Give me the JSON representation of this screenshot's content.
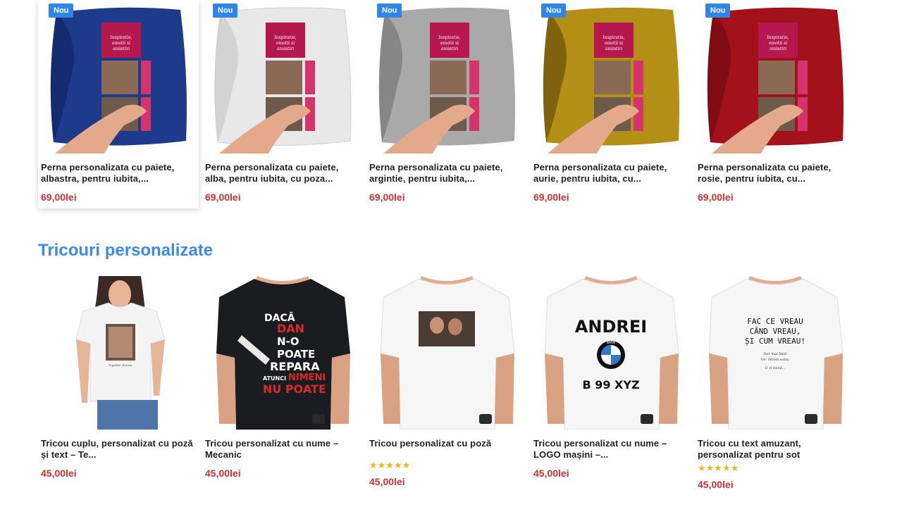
{
  "pillows": [
    {
      "badge": "Nou",
      "title": "Perna personalizata cu paiete, albastra, pentru iubita,...",
      "price": "69,00lei",
      "color": "#1e3a8a",
      "shade": "#0f2160"
    },
    {
      "badge": "Nou",
      "title": "Perna personalizata cu paiete, alba, pentru iubita, cu poza...",
      "price": "69,00lei",
      "color": "#e7e7e7",
      "shade": "#bdbdbd"
    },
    {
      "badge": "Nou",
      "title": "Perna personalizata cu paiete, argintie, pentru iubita,...",
      "price": "69,00lei",
      "color": "#a9a9a9",
      "shade": "#6f6f6f"
    },
    {
      "badge": "Nou",
      "title": "Perna personalizata cu paiete, aurie, pentru iubita, cu...",
      "price": "69,00lei",
      "color": "#b48f16",
      "shade": "#7a5e0a"
    },
    {
      "badge": "Nou",
      "title": "Perna personalizata cu paiete, rosie, pentru iubita, cu...",
      "price": "69,00lei",
      "color": "#a3121a",
      "shade": "#6a0a10"
    }
  ],
  "pillow_print_text": "Inspiratie, emotii si amintiri",
  "section_title": "Tricouri personalizate",
  "shirts": [
    {
      "title": "Tricou cuplu, personalizat cu poză și text – Te...",
      "price": "45,00lei",
      "stars": "",
      "shirt_color": "#f4f4f4"
    },
    {
      "title": "Tricou personalizat cu nume – Mecanic",
      "price": "45,00lei",
      "stars": "",
      "shirt_color": "#1b1c20"
    },
    {
      "title": "Tricou personalizat cu poză",
      "price": "45,00lei",
      "stars": "★★★★★",
      "shirt_color": "#f6f6f6"
    },
    {
      "title": "Tricou personalizat cu nume – LOGO mașini –...",
      "price": "45,00lei",
      "stars": "",
      "shirt_color": "#f6f6f6"
    },
    {
      "title": "Tricou cu text amuzant, personalizat pentru sot",
      "price": "45,00lei",
      "stars": "★★★★★",
      "shirt_color": "#f6f6f6"
    }
  ],
  "shirt_prints": {
    "mecanic": [
      "DACĂ",
      "DAN",
      "N-O",
      "POATE",
      "REPARA",
      "ATUNCI",
      "NIMENI",
      "NU POATE"
    ],
    "logo": [
      "ANDREI",
      "BMW",
      "B 99 XYZ"
    ],
    "text": [
      "FAC CE VREAU",
      "CÂND VREAU,",
      "ȘI CUM VREAU!",
      "Dar mai întâi",
      "tre' întreb soția.",
      "O zi bună..."
    ],
    "couple_caption": "Together forever"
  }
}
